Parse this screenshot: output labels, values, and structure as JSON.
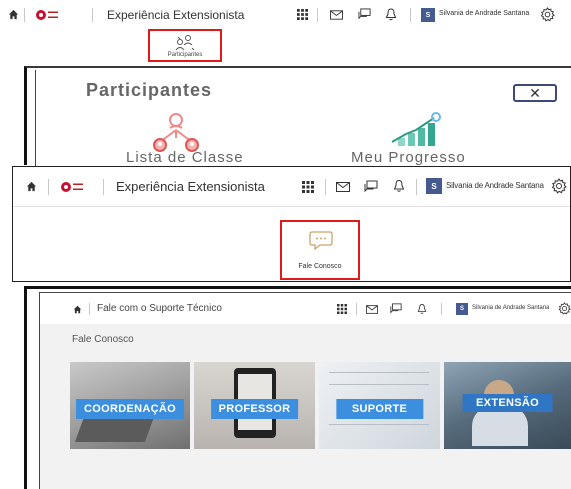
{
  "section1": {
    "app_title": "Experiência Extensionista",
    "user_initial": "S",
    "user_name": "Silvania de Andrade Santana",
    "highlight_label": "Participantes",
    "icons": [
      "home-icon",
      "apps-grid-icon",
      "mail-icon",
      "chat-icon",
      "bell-icon",
      "gear-icon",
      "participants-icon"
    ]
  },
  "section2": {
    "title": "Participantes",
    "close_symbol": "✕",
    "items": [
      {
        "label": "Lista de Classe",
        "icon": "class-list-icon"
      },
      {
        "label": "Meu Progresso",
        "icon": "progress-chart-icon"
      }
    ]
  },
  "section3": {
    "app_title": "Experiência Extensionista",
    "user_initial": "S",
    "user_name": "Silvania de Andrade Santana",
    "highlight_label": "Fale Conosco"
  },
  "section4": {
    "page_title": "Fale com o Suporte Técnico",
    "user_initial": "S",
    "user_name": "Silvania de Andrade Santana",
    "subtitle": "Fale Conosco",
    "tiles": [
      {
        "label": "COORDENAÇÃO"
      },
      {
        "label": "PROFESSOR"
      },
      {
        "label": "SUPORTE"
      },
      {
        "label": "EXTENSÃO"
      }
    ]
  },
  "colors": {
    "highlight_border": "#e01919",
    "avatar": "#455a8f",
    "tile_label": "#3c8ede",
    "title_gray": "#666666"
  }
}
